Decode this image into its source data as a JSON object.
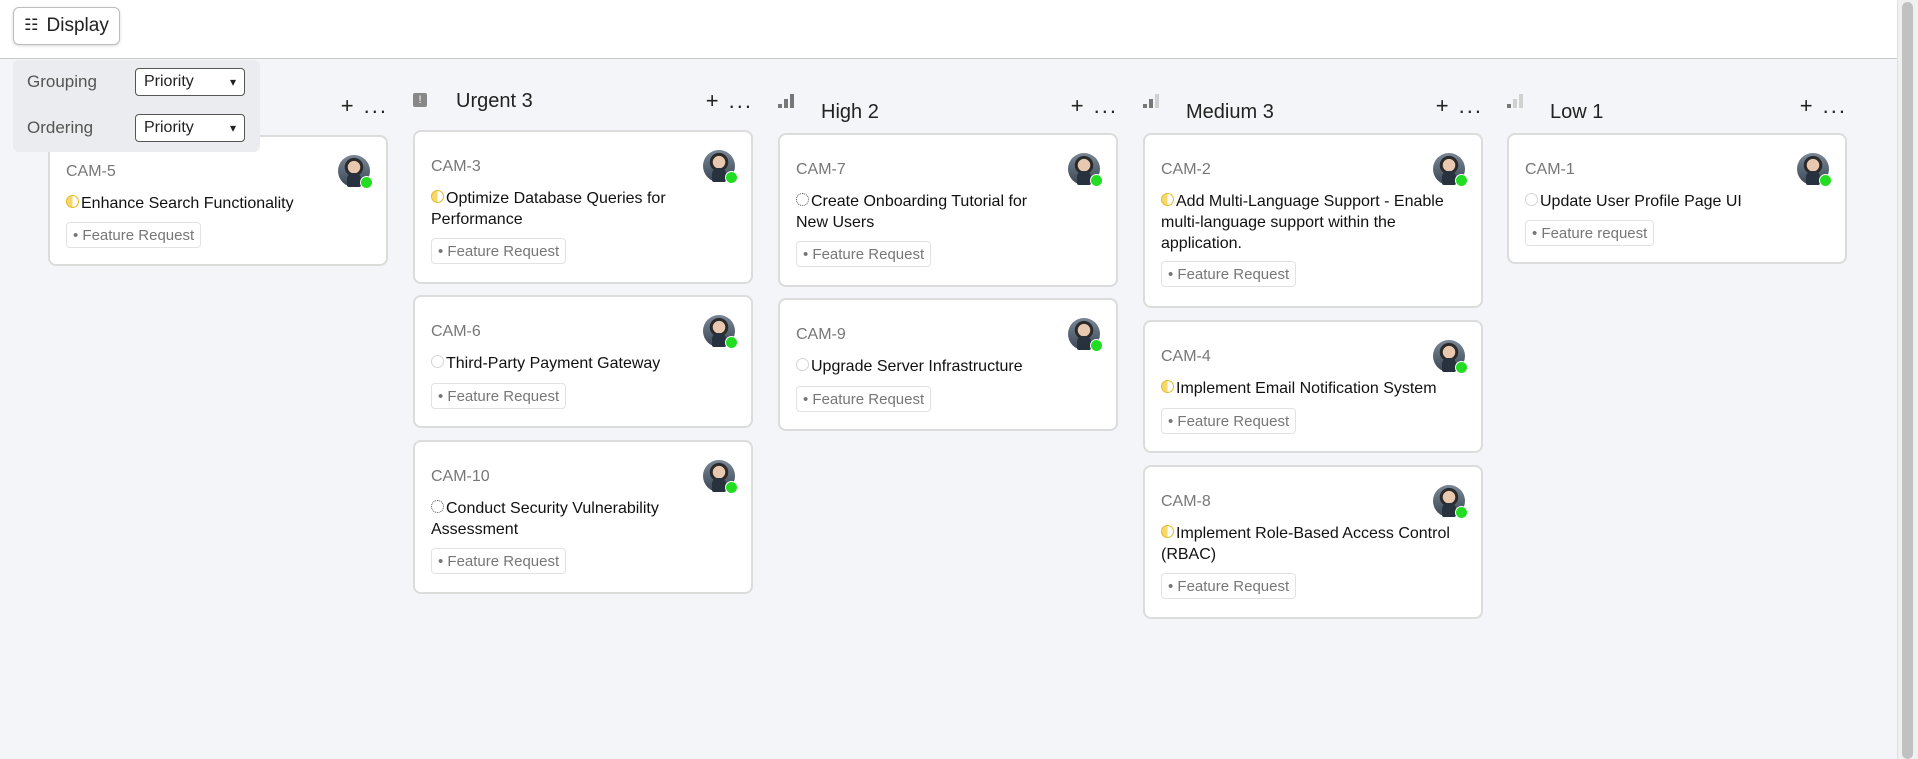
{
  "toolbar": {
    "display_label": "Display",
    "display_icon": "list-icon"
  },
  "display_menu": {
    "grouping_label": "Grouping",
    "grouping_value": "Priority",
    "ordering_label": "Ordering",
    "ordering_value": "Priority"
  },
  "columns": [
    {
      "title": "",
      "actions": "+ ...",
      "cards": [
        {
          "id": "CAM-5",
          "title": "Enhance Search Functionality",
          "status": "in-progress",
          "tag": "• Feature Request"
        }
      ]
    },
    {
      "title": "Urgent 3",
      "icon": "urgent-icon",
      "actions": "+ ...",
      "cards": [
        {
          "id": "CAM-3",
          "title": "Optimize Database Queries for Performance",
          "status": "in-progress",
          "tag": "• Feature Request"
        },
        {
          "id": "CAM-6",
          "title": "Third-Party Payment Gateway",
          "status": "todo",
          "tag": "• Feature Request"
        },
        {
          "id": "CAM-10",
          "title": "Conduct Security Vulnerability Assessment",
          "status": "backlog",
          "tag": "• Feature Request"
        }
      ]
    },
    {
      "title": "High 2",
      "icon": "signal-high-icon",
      "actions": "+ ...",
      "cards": [
        {
          "id": "CAM-7",
          "title": "Create Onboarding Tutorial for New Users",
          "status": "backlog",
          "tag": "• Feature Request"
        },
        {
          "id": "CAM-9",
          "title": "Upgrade Server Infrastructure",
          "status": "todo",
          "tag": "• Feature Request"
        }
      ]
    },
    {
      "title": "Medium 3",
      "icon": "signal-medium-icon",
      "actions": "+ ...",
      "cards": [
        {
          "id": "CAM-2",
          "title": "Add Multi-Language Support - Enable multi-language support within the application.",
          "status": "in-progress",
          "tag": "• Feature Request"
        },
        {
          "id": "CAM-4",
          "title": "Implement Email Notification System",
          "status": "in-progress",
          "tag": "• Feature Request"
        },
        {
          "id": "CAM-8",
          "title": "Implement Role-Based Access Control (RBAC)",
          "status": "in-progress",
          "tag": "• Feature Request"
        }
      ]
    },
    {
      "title": "Low 1",
      "icon": "signal-low-icon",
      "actions": "+ ...",
      "cards": [
        {
          "id": "CAM-1",
          "title": "Update User Profile Page UI",
          "status": "todo",
          "tag": "• Feature request"
        }
      ]
    }
  ],
  "colors": {
    "background": "#f4f5f8",
    "card_border": "#dcdcdc",
    "online_dot": "#22dd22",
    "in_progress": "#e7b923"
  }
}
